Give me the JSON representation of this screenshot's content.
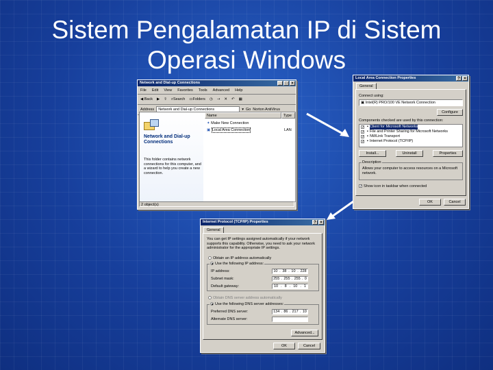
{
  "slide": {
    "title_line1": "Sistem Pengalamatan IP di Sistem",
    "title_line2": "Operasi Windows"
  },
  "colors": {
    "slide_bg": "#1646a8",
    "title_bar": "#0a246a",
    "window_face": "#d4d0c8"
  },
  "explorer": {
    "title": "Network and Dial-up Connections",
    "menu": [
      "File",
      "Edit",
      "View",
      "Favorites",
      "Tools",
      "Advanced",
      "Help"
    ],
    "toolbar": {
      "back": "Back",
      "search": "Search",
      "folders": "Folders"
    },
    "address_label": "Address",
    "address_value": "Network and Dial-up Connections",
    "go_label": "Go",
    "norton_label": "Norton AntiVirus",
    "panel_title": "Network and Dial-up Connections",
    "panel_text": "This folder contains network connections for this computer, and a wizard to help you create a new connection.",
    "columns": [
      "Name",
      "Type"
    ],
    "items": [
      {
        "name": "Make New Connection",
        "type": ""
      },
      {
        "name": "Local Area Connection",
        "type": "LAN"
      }
    ],
    "status": "2 object(s)"
  },
  "lan_properties": {
    "title": "Local Area Connection Properties",
    "tab": "General",
    "connect_using_label": "Connect using:",
    "adapter": "Intel(R) PRO/100 VE Network Connection",
    "configure_button": "Configure",
    "components_label": "Components checked are used by this connection:",
    "components": [
      {
        "label": "Client for Microsoft Networks",
        "checked": true,
        "selected": true
      },
      {
        "label": "File and Printer Sharing for Microsoft Networks",
        "checked": true,
        "selected": false
      },
      {
        "label": "NWLink Transport",
        "checked": true,
        "selected": false
      },
      {
        "label": "Internet Protocol (TCP/IP)",
        "checked": true,
        "selected": false
      }
    ],
    "install_button": "Install...",
    "uninstall_button": "Uninstall",
    "properties_button": "Properties",
    "description_label": "Description",
    "description_text": "Allows your computer to access resources on a Microsoft network.",
    "show_icon_label": "Show icon in taskbar when connected",
    "ok_button": "OK",
    "cancel_button": "Cancel"
  },
  "tcpip_properties": {
    "title": "Internet Protocol (TCP/IP) Properties",
    "tab": "General",
    "intro": "You can get IP settings assigned automatically if your network supports this capability. Otherwise, you need to ask your network administrator for the appropriate IP settings.",
    "auto_ip_label": "Obtain an IP address automatically",
    "manual_ip_label": "Use the following IP address:",
    "ip_label": "IP address:",
    "ip_value": [
      "10",
      "38",
      "10",
      "228"
    ],
    "subnet_label": "Subnet mask:",
    "subnet_value": [
      "255",
      "255",
      "255",
      "0"
    ],
    "gateway_label": "Default gateway:",
    "gateway_value": [
      "10",
      "8",
      "10",
      "1"
    ],
    "auto_dns_label": "Obtain DNS server address automatically",
    "manual_dns_label": "Use the following DNS server addresses:",
    "preferred_dns_label": "Preferred DNS server:",
    "preferred_dns_value": [
      "134",
      "86",
      "217",
      "10"
    ],
    "alternate_dns_label": "Alternate DNS server:",
    "advanced_button": "Advanced...",
    "ok_button": "OK",
    "cancel_button": "Cancel"
  }
}
